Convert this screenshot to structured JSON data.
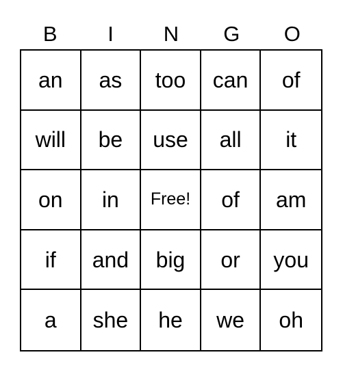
{
  "card": {
    "header": [
      "B",
      "I",
      "N",
      "G",
      "O"
    ],
    "rows": [
      [
        "an",
        "as",
        "too",
        "can",
        "of"
      ],
      [
        "will",
        "be",
        "use",
        "all",
        "it"
      ],
      [
        "on",
        "in",
        "Free!",
        "of",
        "am"
      ],
      [
        "if",
        "and",
        "big",
        "or",
        "you"
      ],
      [
        "a",
        "she",
        "he",
        "we",
        "oh"
      ]
    ],
    "free_space": {
      "row": 2,
      "col": 2,
      "label": "Free!"
    }
  }
}
